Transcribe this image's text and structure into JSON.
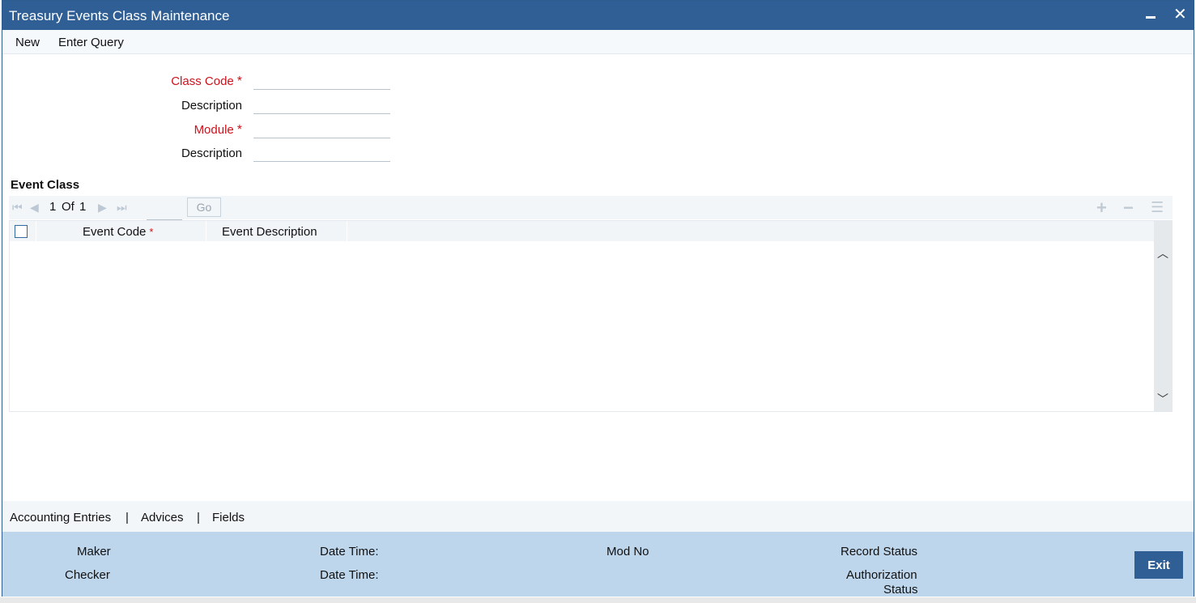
{
  "window": {
    "title": "Treasury Events Class Maintenance",
    "minimize_icon": "minimize-icon",
    "close_icon": "close-icon"
  },
  "menu": {
    "new_label": "New",
    "enter_query_label": "Enter Query"
  },
  "form": {
    "class_code_label": "Class Code",
    "class_code_value": "",
    "class_description_label": "Description",
    "class_description_value": "",
    "module_label": "Module",
    "module_value": "",
    "module_description_label": "Description",
    "module_description_value": "",
    "required_marker": "*"
  },
  "event_class": {
    "section_title": "Event Class",
    "pager": {
      "current": "1",
      "of_label": "Of",
      "total": "1",
      "go_label": "Go"
    },
    "columns": [
      "Event Code",
      "Event Description"
    ],
    "rows": []
  },
  "subtabs": {
    "accounting_entries": "Accounting Entries",
    "advices": "Advices",
    "fields": "Fields",
    "separator": "|"
  },
  "audit": {
    "maker_label": "Maker",
    "checker_label": "Checker",
    "date_time_label_1": "Date Time:",
    "date_time_label_2": "Date Time:",
    "mod_no_label": "Mod No",
    "record_status_label": "Record Status",
    "authorization_label": "Authorization",
    "status_label": "Status",
    "exit_label": "Exit"
  },
  "colors": {
    "title_bar": "#2f5f94",
    "required_text": "#d0101b",
    "audit_bar": "#bed6ec"
  }
}
